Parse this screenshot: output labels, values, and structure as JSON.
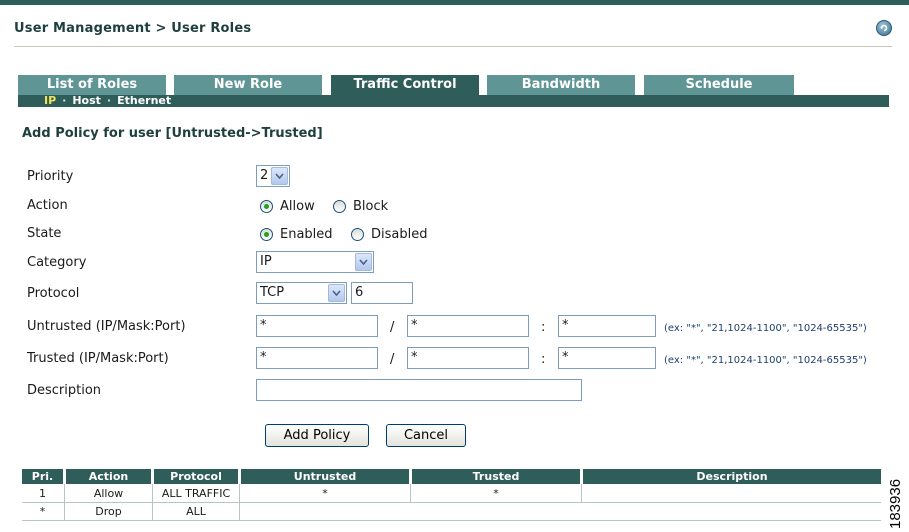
{
  "breadcrumb": "User Management > User Roles",
  "tabs": [
    "List of Roles",
    "New Role",
    "Traffic Control",
    "Bandwidth",
    "Schedule"
  ],
  "active_tab": "Traffic Control",
  "subnav": {
    "ip": "IP",
    "host": "Host",
    "ethernet": "Ethernet",
    "sep": "·"
  },
  "heading": "Add Policy for user [Untrusted->Trusted]",
  "form": {
    "priority": {
      "label": "Priority",
      "value": "2"
    },
    "action": {
      "label": "Action",
      "options": [
        "Allow",
        "Block"
      ],
      "selected": "Allow"
    },
    "state": {
      "label": "State",
      "options": [
        "Enabled",
        "Disabled"
      ],
      "selected": "Enabled"
    },
    "category": {
      "label": "Category",
      "value": "IP"
    },
    "protocol": {
      "label": "Protocol",
      "value": "TCP",
      "number": "6"
    },
    "untrusted": {
      "label": "Untrusted (IP/Mask:Port)",
      "ip": "*",
      "mask": "*",
      "port": "*"
    },
    "trusted": {
      "label": "Trusted (IP/Mask:Port)",
      "ip": "*",
      "mask": "*",
      "port": "*"
    },
    "description": {
      "label": "Description",
      "value": ""
    },
    "slash": "/",
    "colon": ":",
    "hint": "(ex: \"*\", \"21,1024-1100\", \"1024-65535\")"
  },
  "buttons": {
    "add": "Add Policy",
    "cancel": "Cancel"
  },
  "table": {
    "headers": [
      "Pri.",
      "Action",
      "Protocol",
      "Untrusted",
      "Trusted",
      "Description"
    ],
    "rows": [
      [
        "1",
        "Allow",
        "ALL TRAFFIC",
        "*",
        "*",
        ""
      ],
      [
        "*",
        "Drop",
        "ALL",
        "",
        "",
        ""
      ]
    ]
  },
  "figure_id": "183936",
  "colors": {
    "header": "#2f5d5a",
    "tab": "#5f9594",
    "selected_subnav": "#f1e35b"
  }
}
